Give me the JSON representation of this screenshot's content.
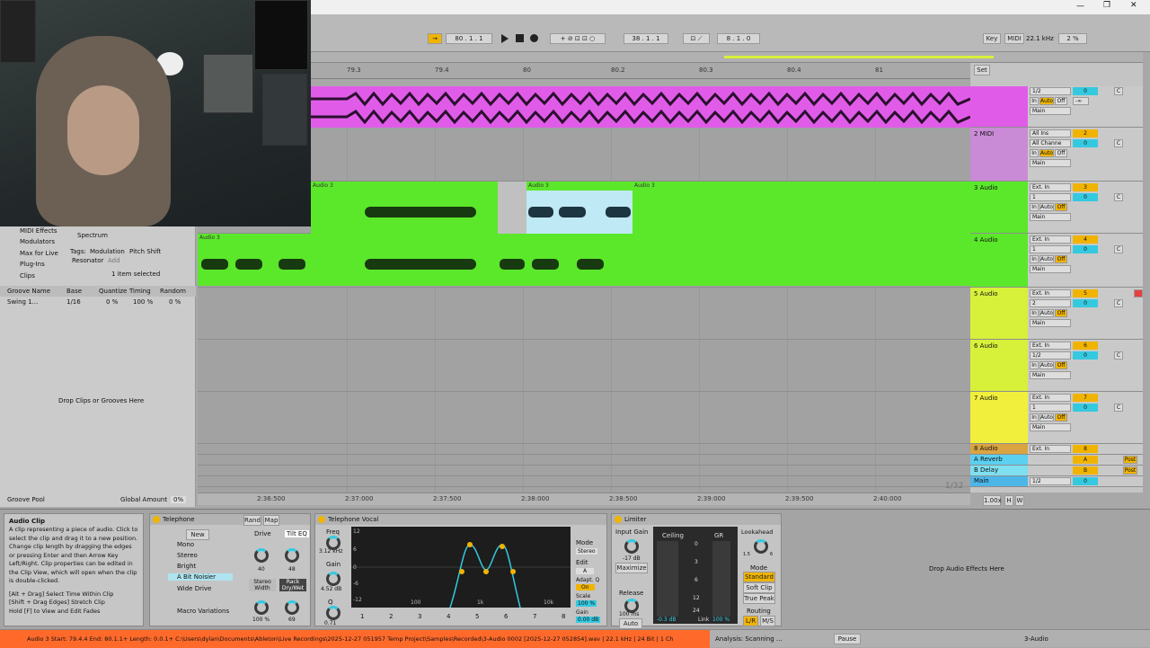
{
  "window": {
    "minimize": "—",
    "maximize": "❐",
    "close": "✕"
  },
  "transport": {
    "follow": "→",
    "position": "80 . 1 . 1",
    "loop_start": "38 . 1 . 1",
    "loop_length": "8 . 1 . 0",
    "key": "Key",
    "midi": "MIDI",
    "sample_rate": "22.1 kHz",
    "cpu": "2 %"
  },
  "ruler": {
    "ticks": [
      "79.3",
      "79.4",
      "80",
      "80.2",
      "80.3",
      "80.4",
      "81"
    ],
    "set_label": "Set"
  },
  "tracks": [
    {
      "name": "",
      "color": "#e05ce8",
      "input": "1/2",
      "num": "0",
      "cs": "C",
      "monitor": [
        "In",
        "Auto",
        "Off"
      ],
      "out": "Main"
    },
    {
      "name": "2 MIDI",
      "color": "#c98bd6",
      "input": "All Ins",
      "chan": "All Channe",
      "num": "2",
      "vol": "0",
      "cs": "C",
      "monitor": [
        "In",
        "Auto",
        "Off"
      ],
      "out": "Main"
    },
    {
      "name": "3 Audio",
      "color": "#5be82a",
      "input": "Ext. In",
      "chan": "1",
      "num": "3",
      "vol": "0",
      "cs": "C",
      "monitor": [
        "In",
        "Auto",
        "Off"
      ],
      "out": "Main"
    },
    {
      "name": "4 Audio",
      "color": "#5be82a",
      "input": "Ext. In",
      "chan": "1",
      "num": "4",
      "vol": "0",
      "cs": "C",
      "monitor": [
        "In",
        "Auto",
        "Off"
      ],
      "out": "Main"
    },
    {
      "name": "5 Audio",
      "color": "#d7f03a",
      "input": "Ext. In",
      "chan": "2",
      "num": "5",
      "vol": "0",
      "cs": "C",
      "monitor": [
        "In",
        "Auto",
        "Off"
      ],
      "out": "Main"
    },
    {
      "name": "6 Audio",
      "color": "#d7f03a",
      "input": "Ext. In",
      "chan": "1/2",
      "num": "6",
      "vol": "0",
      "cs": "C",
      "monitor": [
        "In",
        "Auto",
        "Off"
      ],
      "out": "Main"
    },
    {
      "name": "7 Audio",
      "color": "#f1ef3c",
      "input": "Ext. In",
      "chan": "1",
      "num": "7",
      "vol": "0",
      "cs": "C",
      "monitor": [
        "In",
        "Auto",
        "Off"
      ],
      "out": "Main"
    },
    {
      "name": "8 Audio",
      "color": "#d9a441",
      "input": "Ext. In",
      "num": "8"
    }
  ],
  "returns": [
    {
      "name": "A Reverb",
      "color": "#5bd0f0",
      "letter": "A",
      "post": "Post"
    },
    {
      "name": "B Delay",
      "color": "#7ee0f0",
      "letter": "B",
      "post": "Post"
    },
    {
      "name": "Main",
      "color": "#4cb6e8",
      "out": "1/2",
      "num": "0"
    }
  ],
  "minus_inf": "-∞",
  "clip_label": "Audio 3",
  "clip_label_short": "A",
  "browser": {
    "items": [
      "MIDI Effects",
      "Modulators",
      "Max for Live",
      "Plug-Ins",
      "Clips"
    ],
    "spectrum": "Spectrum",
    "tags_label": "Tags:",
    "tags": [
      "Modulation",
      "Pitch Shift",
      "Resonator",
      "Add"
    ],
    "selected": "1 item selected",
    "groove_headers": [
      "Groove Name",
      "Base",
      "Quantize",
      "Timing",
      "Random"
    ],
    "groove_row": [
      "Swing 1...",
      "1/16",
      "0 %",
      "100 %",
      "0 %"
    ],
    "drop_text": "Drop Clips or Grooves Here",
    "groove_pool": "Groove Pool",
    "global_amount": "Global Amount",
    "global_amount_val": "0%"
  },
  "timeline": {
    "ticks": [
      "2:36:500",
      "2:37:000",
      "2:37:500",
      "2:38:000",
      "2:38:500",
      "2:39:000",
      "2:39:500",
      "2:40:000"
    ],
    "zoom": "1/32",
    "tempo": "1.00x",
    "h": "H",
    "w": "W"
  },
  "info": {
    "title": "Audio Clip",
    "body": "A clip representing a piece of audio. Click to select the clip and drag it to a new position. Change clip length by dragging the edges or pressing Enter and then Arrow Key Left/Right. Clip properties can be edited in the Clip View, which will open when the clip is double-clicked.",
    "hints": [
      "[Alt + Drag] Select Time Within Clip",
      "[Shift + Drag Edges] Stretch Clip",
      "Hold [F] to View and Edit Fades"
    ]
  },
  "telephone": {
    "title": "Telephone",
    "rand": "Rand",
    "map": "Map",
    "new": "New",
    "presets": [
      "Mono",
      "Stereo",
      "Bright",
      "A Bit Noisier",
      "Wide Drive"
    ],
    "drive": "Drive",
    "tilt": "Tilt EQ",
    "drive_val": "40",
    "tilt_val": "48",
    "stereo_width": "Stereo Width",
    "rack": "Rack Dry/Wet",
    "sw_val": "100 %",
    "rack_val": "69",
    "macro": "Macro Variations"
  },
  "telvocal": {
    "title": "Telephone Vocal",
    "freq": "Freq",
    "freq_val": "3.12 kHz",
    "gain": "Gain",
    "gain_val": "4.52 dB",
    "q": "Q",
    "q_val": "0.71",
    "db_ticks": [
      "12",
      "6",
      "0",
      "-6",
      "-12"
    ],
    "hz_ticks": [
      "100",
      "1k",
      "10k"
    ],
    "mode": "Mode",
    "mode_val": "Stereo",
    "edit": "Edit",
    "edit_val": "A",
    "adapt": "Adapt. Q",
    "adapt_val": "On",
    "scale": "Scale",
    "scale_val": "100 %",
    "gain2": "Gain",
    "gain2_val": "0.00 dB",
    "bands": [
      "1",
      "2",
      "3",
      "4",
      "5",
      "6",
      "7",
      "8"
    ]
  },
  "limiter": {
    "title": "Limiter",
    "input_gain": "Input Gain",
    "input_val": "-17 dB",
    "maximize": "Maximize",
    "ceiling": "Ceiling",
    "gr": "GR",
    "gr_ticks": [
      "0",
      "3",
      "6",
      "12",
      "24"
    ],
    "ceiling_val": "-0.3 dB",
    "link": "Link",
    "link_val": "100 %",
    "lookahead": "Lookahead",
    "la_vals": [
      "1.5",
      "6"
    ],
    "mode": "Mode",
    "modes": [
      "Standard",
      "Soft Clip",
      "True Peak"
    ],
    "release": "Release",
    "release_val": "100 ms",
    "auto": "Auto",
    "routing": "Routing",
    "routing_vals": [
      "L/R",
      "M/S"
    ]
  },
  "drop_fx": "Drop Audio Effects Here",
  "status": {
    "message": "Audio 3  Start: 79.4.4  End: 80.1.1+  Length: 0.0.1+  C:\\Users\\dylan\\Documents\\Ableton\\Live Recordings\\2025-12-27 051957 Temp Project\\Samples\\Recorded\\3-Audio 0002 [2025-12-27 052854].wav | 22.1 kHz | 24 Bit | 1 Ch",
    "analysis": "Analysis: Scanning ...",
    "pause": "Pause",
    "track": "3-Audio"
  }
}
